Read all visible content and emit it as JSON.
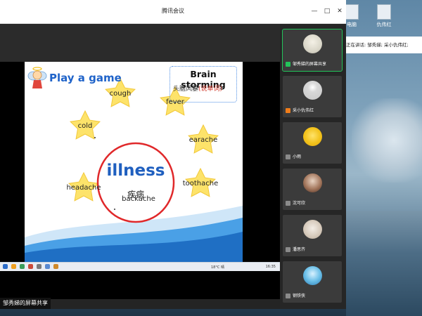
{
  "window": {
    "title": "腾讯会议"
  },
  "desktop": {
    "icons": [
      {
        "label": "电脑"
      },
      {
        "label": "仇伟红"
      }
    ]
  },
  "speaking": {
    "text": "正在讲话: 邹秀娣; 采小仇伟红;"
  },
  "slide": {
    "title": "Play a game",
    "brain_en": "Brain storming",
    "brain_zh": "头脑风暴",
    "brain_hint": "(说单词)",
    "center_word": "illness",
    "center_zh": "疾病",
    "stars": [
      "cough",
      "fever",
      "cold",
      "earache",
      "headache",
      "toothache",
      "backache"
    ]
  },
  "taskbar": {
    "time": "16:35",
    "tray": "18°C 晴"
  },
  "sharer_label": "邹秀娣的屏幕共享",
  "participants": [
    {
      "name": "邹秀娣的屏幕共享",
      "active": true
    },
    {
      "name": "采小仇伟红",
      "active": false
    },
    {
      "name": "小雨",
      "active": false
    },
    {
      "name": "沈可欣",
      "active": false
    },
    {
      "name": "潘思齐",
      "active": false
    },
    {
      "name": "钢铁侠",
      "active": false
    }
  ],
  "colors": {
    "accent_green": "#23c35a",
    "slide_blue": "#1f63c9",
    "circle_red": "#e0282a",
    "star_yellow": "#fde36a"
  }
}
